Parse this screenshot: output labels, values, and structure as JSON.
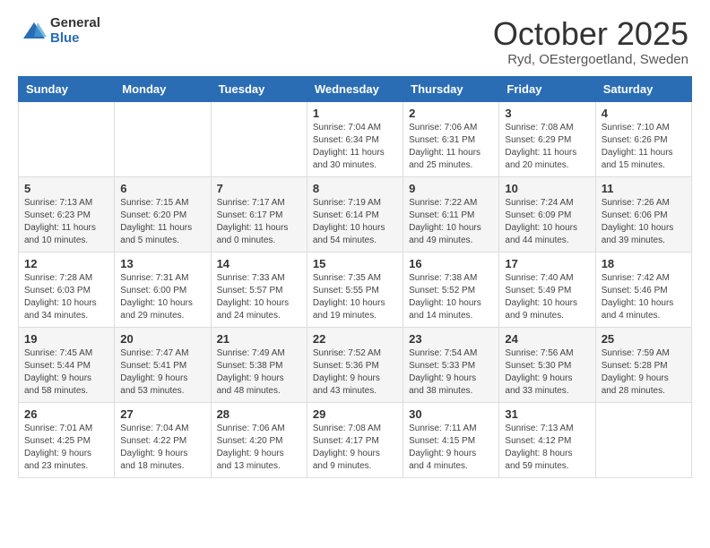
{
  "header": {
    "logo_general": "General",
    "logo_blue": "Blue",
    "month_title": "October 2025",
    "location": "Ryd, OEstergoetland, Sweden"
  },
  "days_of_week": [
    "Sunday",
    "Monday",
    "Tuesday",
    "Wednesday",
    "Thursday",
    "Friday",
    "Saturday"
  ],
  "weeks": [
    [
      {
        "day": "",
        "info": ""
      },
      {
        "day": "",
        "info": ""
      },
      {
        "day": "",
        "info": ""
      },
      {
        "day": "1",
        "info": "Sunrise: 7:04 AM\nSunset: 6:34 PM\nDaylight: 11 hours\nand 30 minutes."
      },
      {
        "day": "2",
        "info": "Sunrise: 7:06 AM\nSunset: 6:31 PM\nDaylight: 11 hours\nand 25 minutes."
      },
      {
        "day": "3",
        "info": "Sunrise: 7:08 AM\nSunset: 6:29 PM\nDaylight: 11 hours\nand 20 minutes."
      },
      {
        "day": "4",
        "info": "Sunrise: 7:10 AM\nSunset: 6:26 PM\nDaylight: 11 hours\nand 15 minutes."
      }
    ],
    [
      {
        "day": "5",
        "info": "Sunrise: 7:13 AM\nSunset: 6:23 PM\nDaylight: 11 hours\nand 10 minutes."
      },
      {
        "day": "6",
        "info": "Sunrise: 7:15 AM\nSunset: 6:20 PM\nDaylight: 11 hours\nand 5 minutes."
      },
      {
        "day": "7",
        "info": "Sunrise: 7:17 AM\nSunset: 6:17 PM\nDaylight: 11 hours\nand 0 minutes."
      },
      {
        "day": "8",
        "info": "Sunrise: 7:19 AM\nSunset: 6:14 PM\nDaylight: 10 hours\nand 54 minutes."
      },
      {
        "day": "9",
        "info": "Sunrise: 7:22 AM\nSunset: 6:11 PM\nDaylight: 10 hours\nand 49 minutes."
      },
      {
        "day": "10",
        "info": "Sunrise: 7:24 AM\nSunset: 6:09 PM\nDaylight: 10 hours\nand 44 minutes."
      },
      {
        "day": "11",
        "info": "Sunrise: 7:26 AM\nSunset: 6:06 PM\nDaylight: 10 hours\nand 39 minutes."
      }
    ],
    [
      {
        "day": "12",
        "info": "Sunrise: 7:28 AM\nSunset: 6:03 PM\nDaylight: 10 hours\nand 34 minutes."
      },
      {
        "day": "13",
        "info": "Sunrise: 7:31 AM\nSunset: 6:00 PM\nDaylight: 10 hours\nand 29 minutes."
      },
      {
        "day": "14",
        "info": "Sunrise: 7:33 AM\nSunset: 5:57 PM\nDaylight: 10 hours\nand 24 minutes."
      },
      {
        "day": "15",
        "info": "Sunrise: 7:35 AM\nSunset: 5:55 PM\nDaylight: 10 hours\nand 19 minutes."
      },
      {
        "day": "16",
        "info": "Sunrise: 7:38 AM\nSunset: 5:52 PM\nDaylight: 10 hours\nand 14 minutes."
      },
      {
        "day": "17",
        "info": "Sunrise: 7:40 AM\nSunset: 5:49 PM\nDaylight: 10 hours\nand 9 minutes."
      },
      {
        "day": "18",
        "info": "Sunrise: 7:42 AM\nSunset: 5:46 PM\nDaylight: 10 hours\nand 4 minutes."
      }
    ],
    [
      {
        "day": "19",
        "info": "Sunrise: 7:45 AM\nSunset: 5:44 PM\nDaylight: 9 hours\nand 58 minutes."
      },
      {
        "day": "20",
        "info": "Sunrise: 7:47 AM\nSunset: 5:41 PM\nDaylight: 9 hours\nand 53 minutes."
      },
      {
        "day": "21",
        "info": "Sunrise: 7:49 AM\nSunset: 5:38 PM\nDaylight: 9 hours\nand 48 minutes."
      },
      {
        "day": "22",
        "info": "Sunrise: 7:52 AM\nSunset: 5:36 PM\nDaylight: 9 hours\nand 43 minutes."
      },
      {
        "day": "23",
        "info": "Sunrise: 7:54 AM\nSunset: 5:33 PM\nDaylight: 9 hours\nand 38 minutes."
      },
      {
        "day": "24",
        "info": "Sunrise: 7:56 AM\nSunset: 5:30 PM\nDaylight: 9 hours\nand 33 minutes."
      },
      {
        "day": "25",
        "info": "Sunrise: 7:59 AM\nSunset: 5:28 PM\nDaylight: 9 hours\nand 28 minutes."
      }
    ],
    [
      {
        "day": "26",
        "info": "Sunrise: 7:01 AM\nSunset: 4:25 PM\nDaylight: 9 hours\nand 23 minutes."
      },
      {
        "day": "27",
        "info": "Sunrise: 7:04 AM\nSunset: 4:22 PM\nDaylight: 9 hours\nand 18 minutes."
      },
      {
        "day": "28",
        "info": "Sunrise: 7:06 AM\nSunset: 4:20 PM\nDaylight: 9 hours\nand 13 minutes."
      },
      {
        "day": "29",
        "info": "Sunrise: 7:08 AM\nSunset: 4:17 PM\nDaylight: 9 hours\nand 9 minutes."
      },
      {
        "day": "30",
        "info": "Sunrise: 7:11 AM\nSunset: 4:15 PM\nDaylight: 9 hours\nand 4 minutes."
      },
      {
        "day": "31",
        "info": "Sunrise: 7:13 AM\nSunset: 4:12 PM\nDaylight: 8 hours\nand 59 minutes."
      },
      {
        "day": "",
        "info": ""
      }
    ]
  ]
}
